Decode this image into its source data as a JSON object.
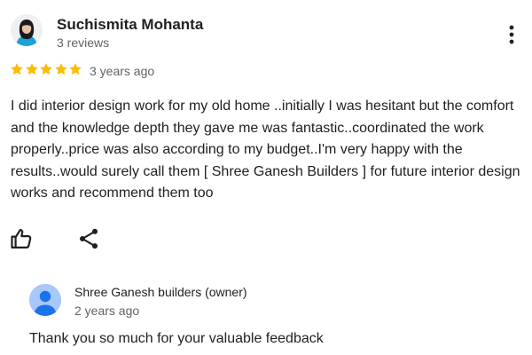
{
  "reviewer": {
    "name": "Suchismita Mohanta",
    "meta": "3 reviews",
    "avatar_icon": "user-photo-avatar"
  },
  "review": {
    "rating": 5,
    "rating_max": 5,
    "star_color": "#fbbc04",
    "time": "3 years ago",
    "text": "I did interior design work for my old home ..initially I was hesitant but the comfort and the knowledge depth they gave me was fantastic..coordinated the work properly..price was also according to my budget..I'm very happy with the results..would surely call them [ Shree Ganesh Builders ] for future interior design works and recommend them too"
  },
  "actions": {
    "like_icon": "thumbs-up-icon",
    "share_icon": "share-icon",
    "more_icon": "more-vertical-icon"
  },
  "owner_response": {
    "name": "Shree Ganesh builders (owner)",
    "time": "2 years ago",
    "text": "Thank you so much for your valuable feedback",
    "avatar_icon": "person-avatar-icon",
    "avatar_color": "#a8c7fa"
  }
}
